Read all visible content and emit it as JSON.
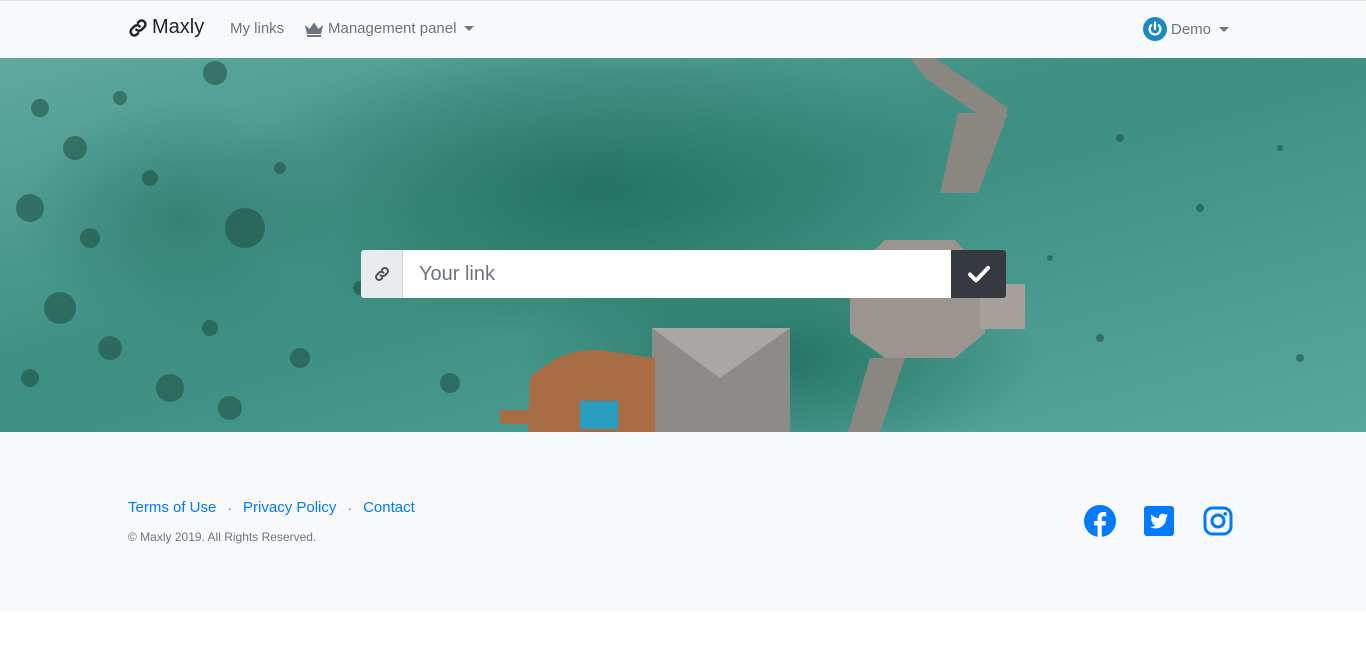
{
  "navbar": {
    "brand": "Maxly",
    "brand_icon": "link-icon",
    "links": [
      {
        "label": "My links"
      },
      {
        "label": "Management panel",
        "icon": "crown-icon",
        "dropdown": true
      }
    ],
    "user": {
      "label": "Demo",
      "icon": "power-icon",
      "dropdown": true
    }
  },
  "hero": {
    "input_prefix_icon": "link-icon",
    "input_placeholder": "Your link",
    "submit_icon": "check-icon"
  },
  "footer": {
    "links": [
      {
        "label": "Terms of Use"
      },
      {
        "label": "Privacy Policy"
      },
      {
        "label": "Contact"
      }
    ],
    "separator": "·",
    "copyright": "© Maxly 2019. All Rights Reserved.",
    "social": [
      {
        "icon": "facebook-icon"
      },
      {
        "icon": "twitter-icon"
      },
      {
        "icon": "instagram-icon"
      }
    ]
  },
  "colors": {
    "accent": "#007bff",
    "navbar_bg": "#f8f9fa",
    "submit_bg": "#343a40",
    "water": "#3f8f85"
  }
}
